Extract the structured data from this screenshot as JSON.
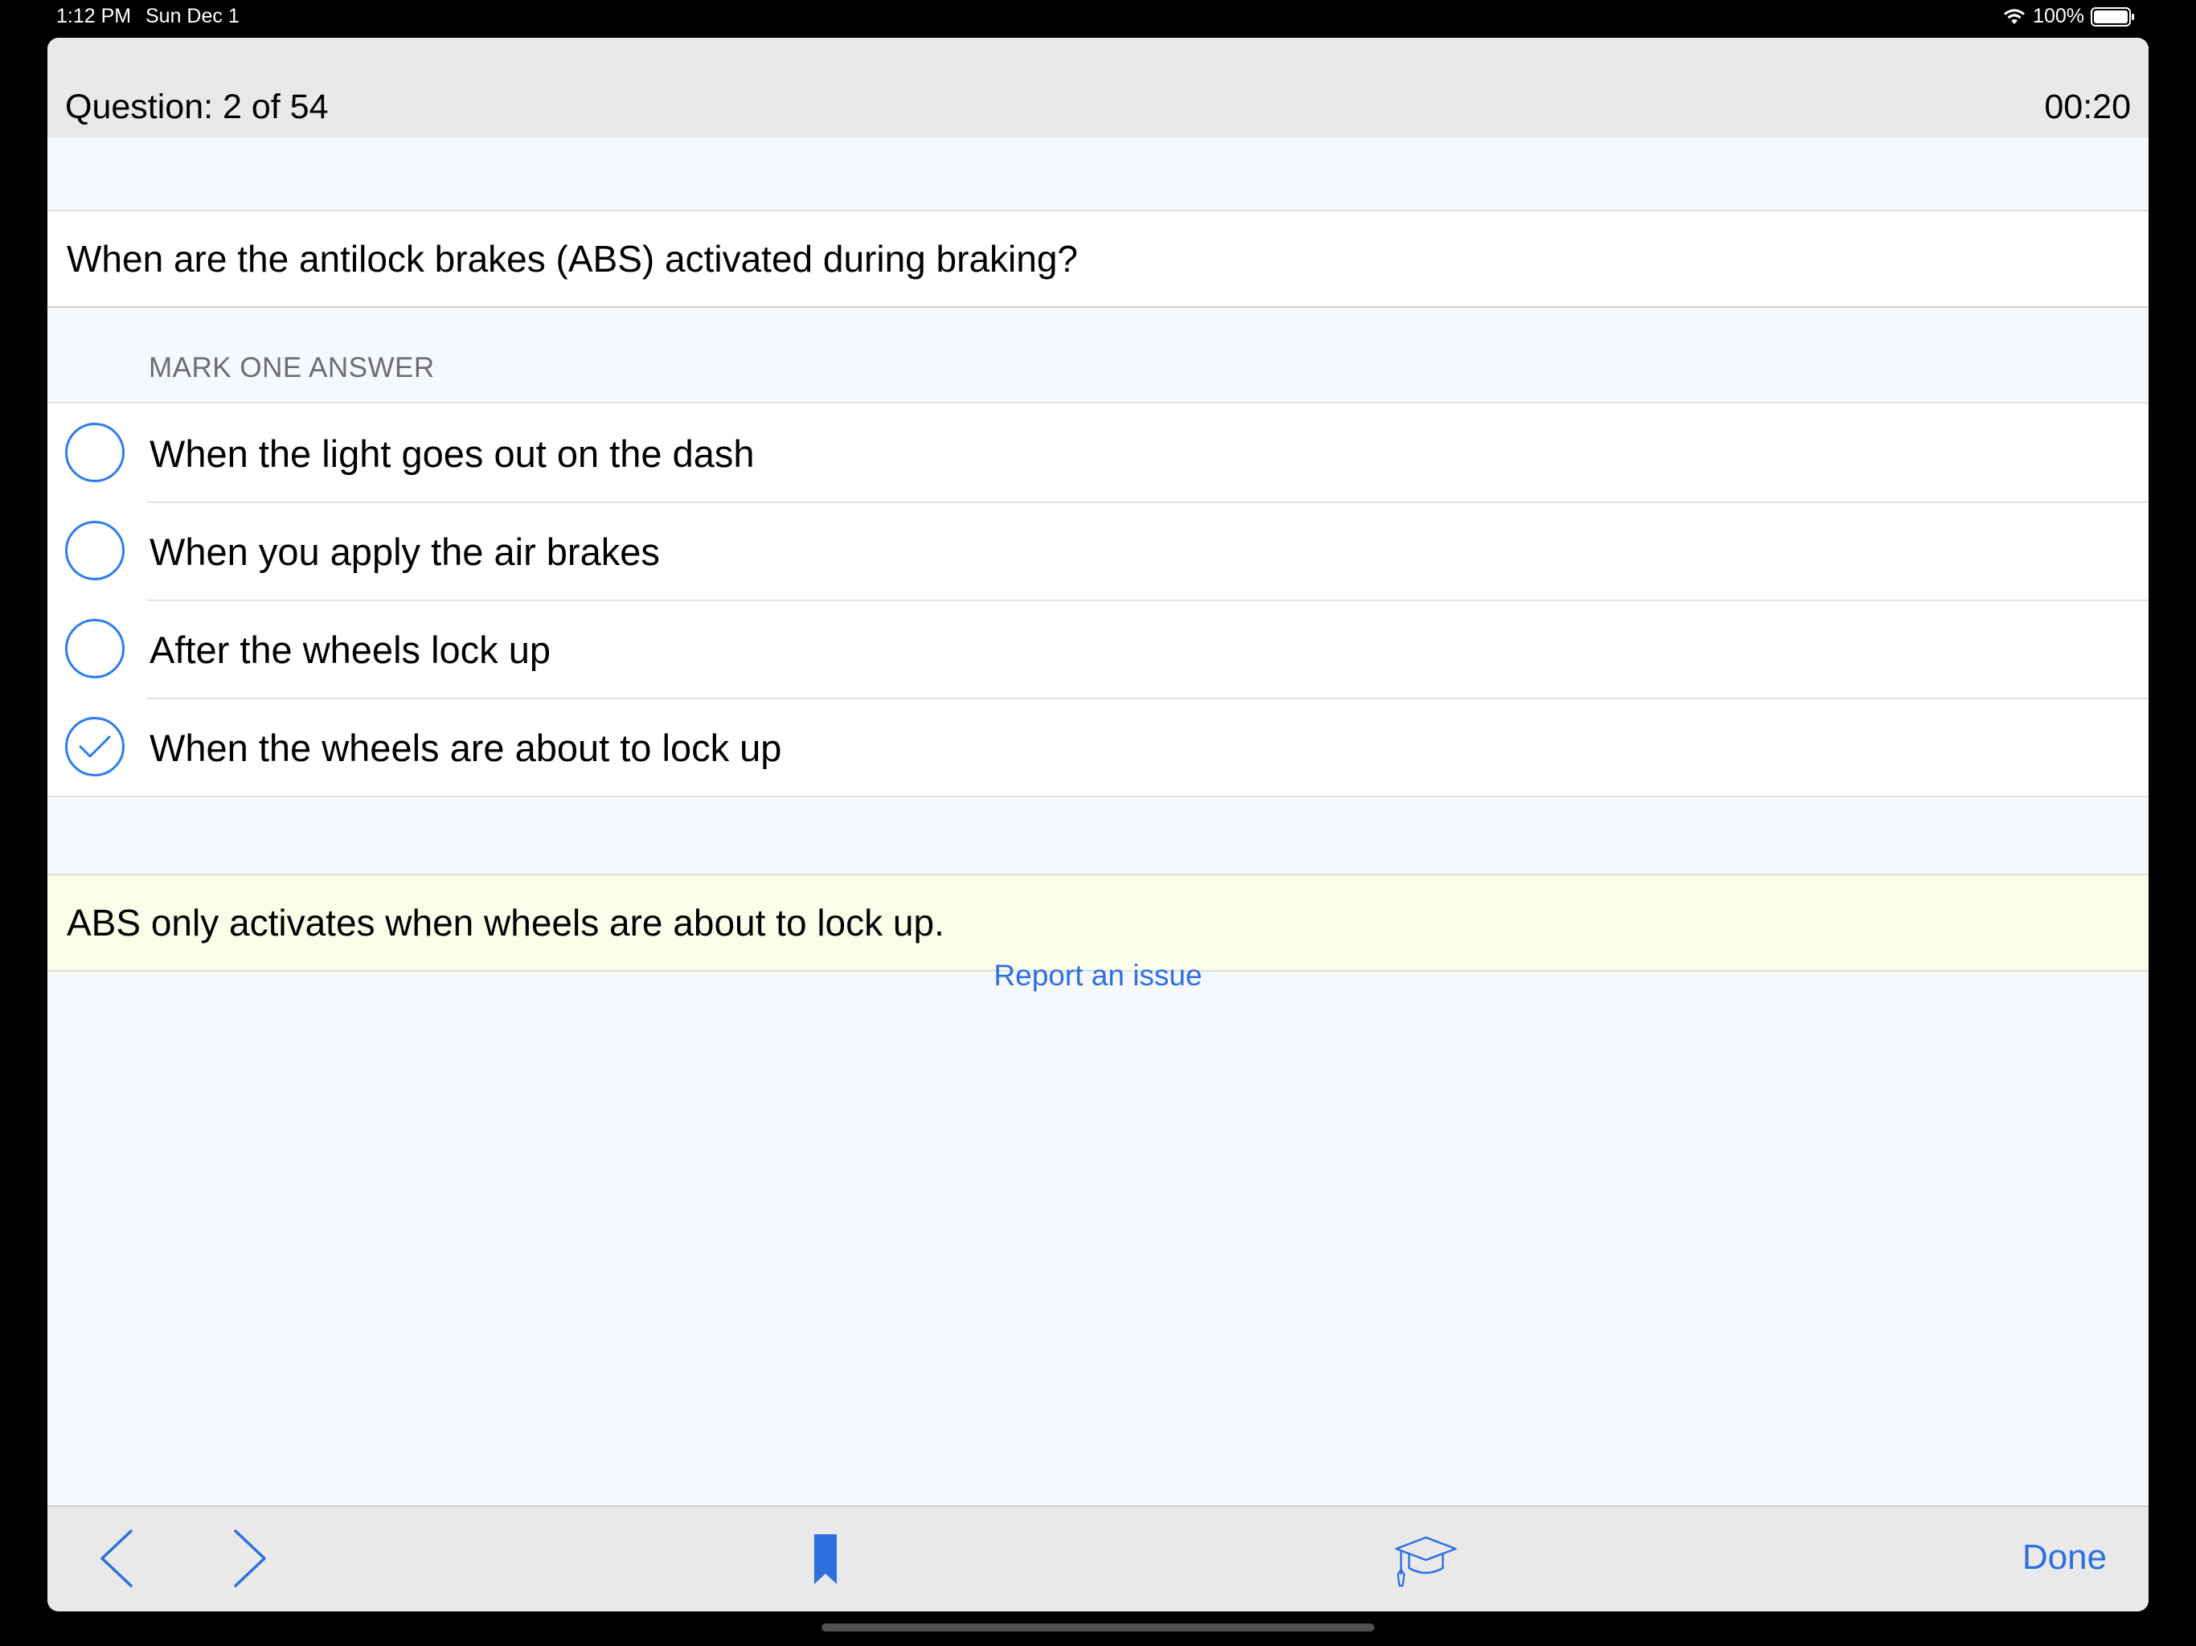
{
  "status_bar": {
    "time": "1:12 PM",
    "date": "Sun Dec 1",
    "battery": "100%"
  },
  "header": {
    "title": "Question: 2 of 54",
    "timer": "00:20"
  },
  "question": {
    "text": "When are the antilock brakes (ABS) activated during braking?"
  },
  "answers_section": {
    "label": "MARK ONE ANSWER",
    "options": [
      {
        "label": "When the light goes out on the dash",
        "selected": false
      },
      {
        "label": "When you apply the air brakes",
        "selected": false
      },
      {
        "label": "After the wheels lock up",
        "selected": false
      },
      {
        "label": "When the wheels are about to lock up",
        "selected": true
      }
    ]
  },
  "explanation": {
    "text": "ABS only activates when wheels are about to lock up."
  },
  "report_link": {
    "label": "Report an issue"
  },
  "toolbar": {
    "back_icon": "chevron-left-icon",
    "forward_icon": "chevron-right-icon",
    "bookmark_icon": "bookmark-icon",
    "study_icon": "graduation-cap-icon",
    "done_label": "Done"
  },
  "colors": {
    "accent": "#2e6fe0",
    "header_bg": "#e9e9ea",
    "explanation_bg": "#fcfde8",
    "page_bg": "#f6f9fc"
  }
}
